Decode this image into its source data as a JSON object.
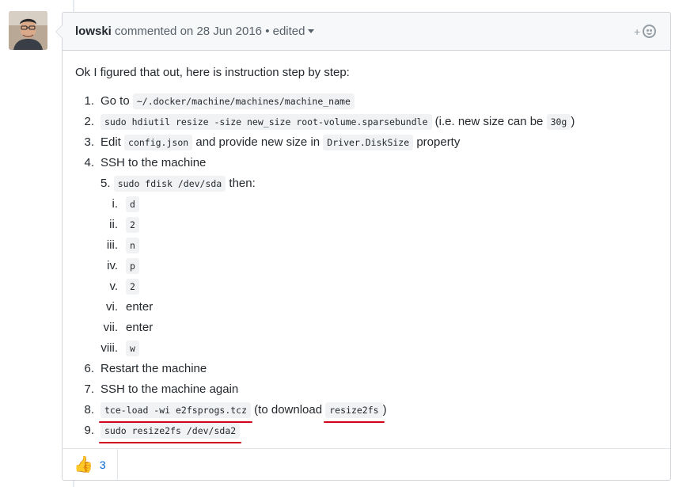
{
  "comment": {
    "author": "lowski",
    "action": "commented on",
    "date": "28 Jun 2016",
    "separator": "•",
    "edited_label": "edited",
    "add_reaction_icon": "smiley-plus-icon",
    "intro": "Ok I figured that out, here is instruction step by step:",
    "steps": {
      "s1": {
        "num": "1.",
        "text": "Go to ",
        "code": "~/.docker/machine/machines/machine_name"
      },
      "s2": {
        "num": "2.",
        "code": "sudo hdiutil resize -size new_size root-volume.sparsebundle",
        "text": " (i.e. new size can be ",
        "code2": "30g",
        "text2": ")"
      },
      "s3": {
        "num": "3.",
        "text": "Edit ",
        "code": "config.json",
        "text2": " and provide new size in ",
        "code2": "Driver.DiskSize",
        "text3": " property"
      },
      "s4": {
        "num": "4.",
        "text": "SSH to the machine"
      },
      "s5": {
        "num": "5.",
        "code": "sudo fdisk /dev/sda",
        "text": " then:",
        "sub": [
          {
            "num": "i.",
            "code": "d"
          },
          {
            "num": "ii.",
            "code": "2"
          },
          {
            "num": "iii.",
            "code": "n"
          },
          {
            "num": "iv.",
            "code": "p"
          },
          {
            "num": "v.",
            "code": "2"
          },
          {
            "num": "vi.",
            "text": "enter"
          },
          {
            "num": "vii.",
            "text": "enter"
          },
          {
            "num": "viii.",
            "code": "w"
          }
        ]
      },
      "s6": {
        "num": "6.",
        "text": "Restart the machine"
      },
      "s7": {
        "num": "7.",
        "text": "SSH to the machine again"
      },
      "s8": {
        "num": "8.",
        "code": "tce-load -wi e2fsprogs.tcz",
        "text": " (to download ",
        "code2": "resize2fs",
        "text2": ")"
      },
      "s9": {
        "num": "9.",
        "code": "sudo resize2fs /dev/sda2"
      }
    },
    "reactions": {
      "thumbs_up_icon": "thumbs-up-icon",
      "count": "3"
    }
  },
  "colors": {
    "underline_accent": "#d0021b",
    "link": "#0366d6"
  }
}
